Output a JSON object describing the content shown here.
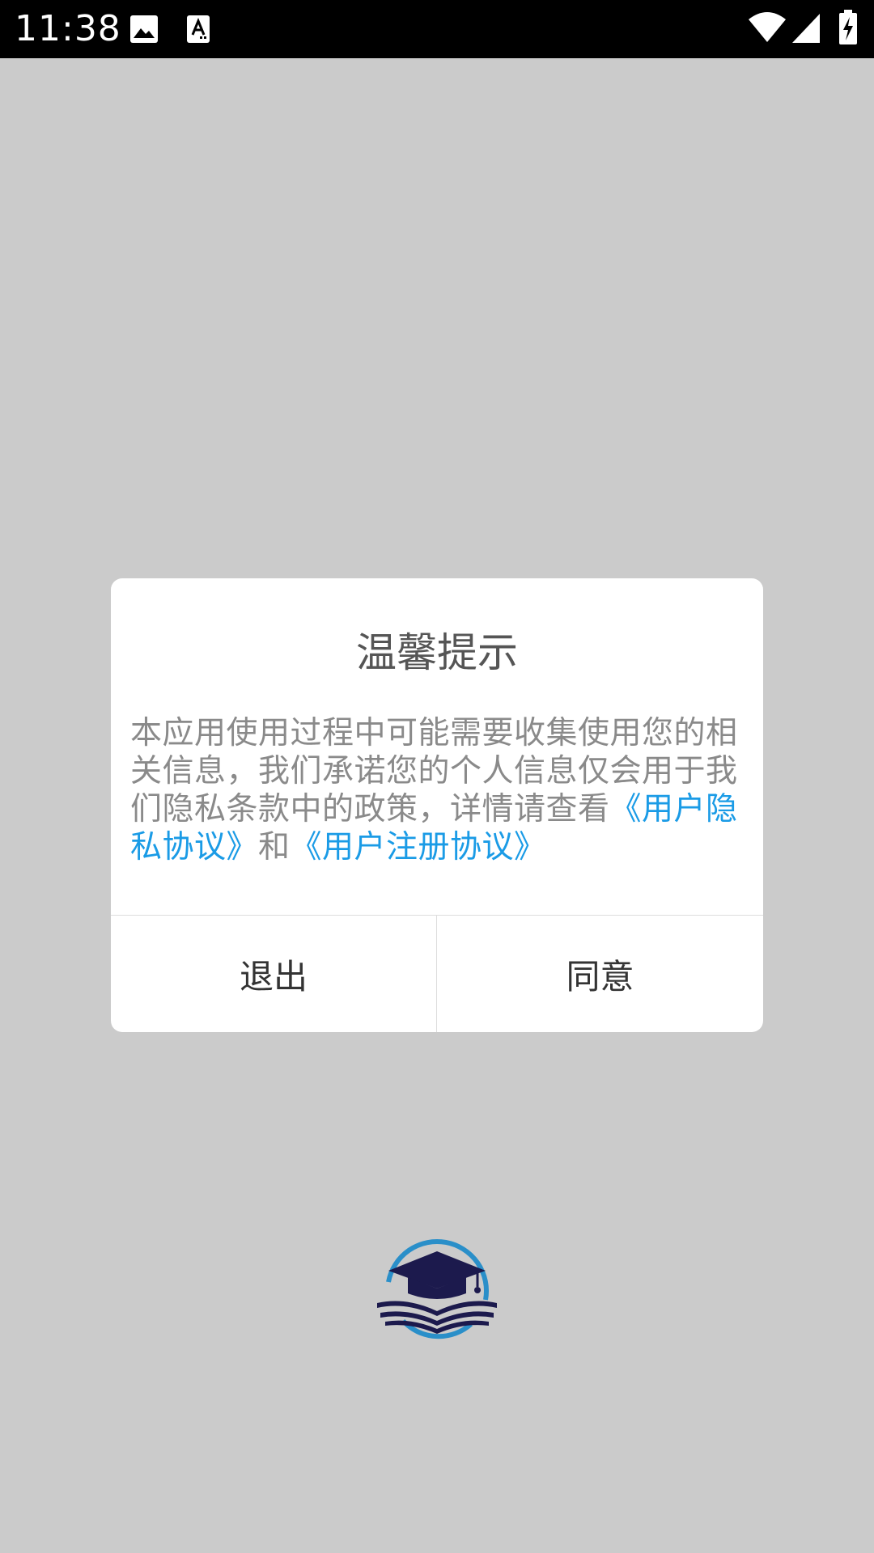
{
  "status_bar": {
    "time": "11:38",
    "icons": [
      "image-icon",
      "text-a-icon",
      "wifi-icon",
      "signal-icon",
      "battery-charging-icon"
    ]
  },
  "dialog": {
    "title": "温馨提示",
    "body_text": "本应用使用过程中可能需要收集使用您的相关信息，我们承诺您的个人信息仅会用于我们隐私条款中的政策，详情请查看",
    "privacy_link": "《用户隐私协议》",
    "connector": "和",
    "register_link": "《用户注册协议》",
    "exit_label": "退出",
    "agree_label": "同意"
  },
  "colors": {
    "overlay": "#cbcbcb",
    "link": "#1a9be6",
    "logo_navy": "#1c1a4d",
    "logo_blue": "#2a8fc9"
  },
  "logo": {
    "icon": "graduation-cap-book-icon"
  }
}
